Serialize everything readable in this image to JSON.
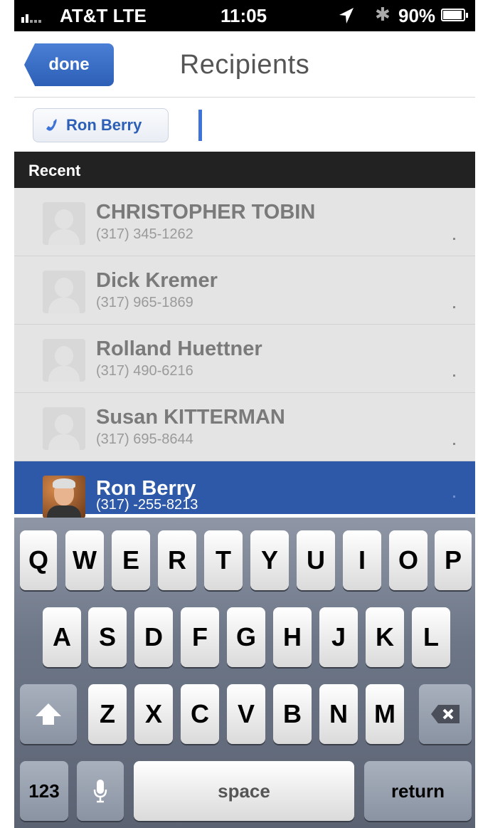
{
  "status_bar": {
    "carrier": "AT&T  LTE",
    "time": "11:05",
    "battery": "90%"
  },
  "nav": {
    "done_label": "done",
    "title": "Recipients"
  },
  "recipient_chip": {
    "label": "Ron Berry",
    "icon": "phone-icon"
  },
  "section": {
    "title": "Recent"
  },
  "contacts": [
    {
      "name": "CHRISTOPHER TOBIN",
      "phone": "(317) 345-1262"
    },
    {
      "name": "Dick Kremer",
      "phone": "(317) 965-1869"
    },
    {
      "name": "Rolland Huettner",
      "phone": "(317) 490-6216"
    },
    {
      "name": "Susan KITTERMAN",
      "phone": "(317) 695-8644"
    },
    {
      "name": "Ron Berry",
      "phone": "(317) -255-8213",
      "selected": true
    }
  ],
  "keyboard": {
    "row1": [
      "Q",
      "W",
      "E",
      "R",
      "T",
      "Y",
      "U",
      "I",
      "O",
      "P"
    ],
    "row2": [
      "A",
      "S",
      "D",
      "F",
      "G",
      "H",
      "J",
      "K",
      "L"
    ],
    "row3": [
      "Z",
      "X",
      "C",
      "V",
      "B",
      "N",
      "M"
    ],
    "num_label": "123",
    "space_label": "space",
    "return_label": "return"
  }
}
